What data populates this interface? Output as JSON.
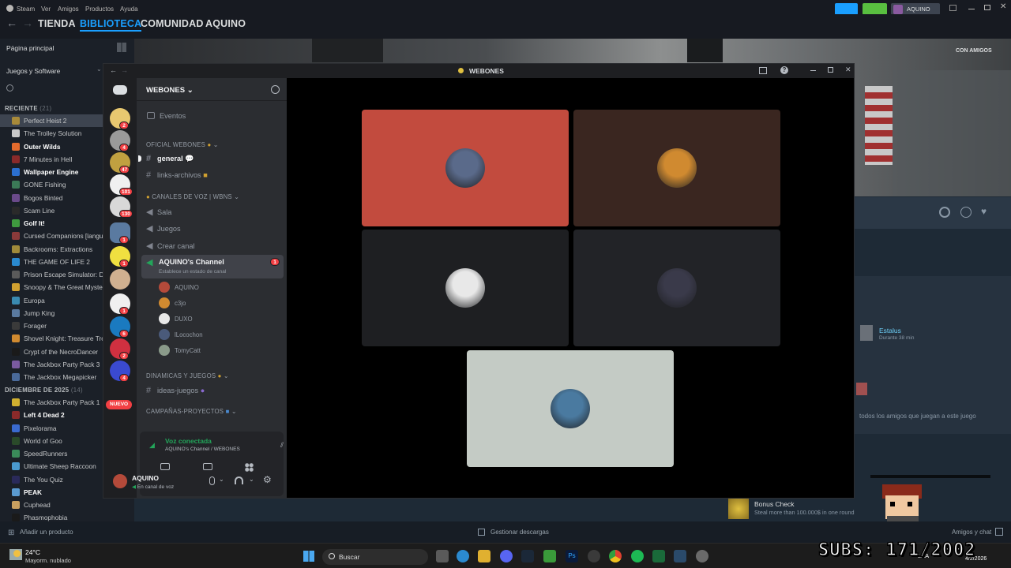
{
  "steam": {
    "menu": [
      "Steam",
      "Ver",
      "Amigos",
      "Productos",
      "Ayuda"
    ],
    "nav": {
      "store": "TIENDA",
      "library": "BIBLIOTECA",
      "community": "COMUNIDAD",
      "user": "AQUINO"
    },
    "account": "AQUINO",
    "home": "Página principal",
    "filter": "Juegos y Software",
    "recent_header": "RECIENTE",
    "recent_count": "(21)",
    "recent": [
      {
        "name": "Perfect Heist 2",
        "bold": false,
        "sel": true,
        "color": "#a88a3a"
      },
      {
        "name": "The Trolley Solution",
        "bold": false,
        "color": "#c9c9c9"
      },
      {
        "name": "Outer Wilds",
        "bold": true,
        "color": "#e46b2d"
      },
      {
        "name": "7 Minutes in Hell",
        "bold": false,
        "color": "#8a2a2a"
      },
      {
        "name": "Wallpaper Engine",
        "bold": true,
        "color": "#2b6fd0"
      },
      {
        "name": "GONE Fishing",
        "bold": false,
        "color": "#3b7a57"
      },
      {
        "name": "Bogos Binted",
        "bold": false,
        "color": "#6a4a8a"
      },
      {
        "name": "Scam Line",
        "bold": false,
        "color": "#2a2a2a"
      },
      {
        "name": "Golf It!",
        "bold": true,
        "color": "#3f9a3f"
      },
      {
        "name": "Cursed Companions [langu",
        "bold": false,
        "color": "#8a3a3a"
      },
      {
        "name": "Backrooms: Extractions",
        "bold": false,
        "color": "#a08a3a"
      },
      {
        "name": "THE GAME OF LIFE 2",
        "bold": false,
        "color": "#2a8ad0"
      },
      {
        "name": "Prison Escape Simulator: D",
        "bold": false,
        "color": "#5a5a5a"
      },
      {
        "name": "Snoopy & The Great Myste",
        "bold": false,
        "color": "#d0a030"
      },
      {
        "name": "Europa",
        "bold": false,
        "color": "#3a8ab0"
      },
      {
        "name": "Jump King",
        "bold": false,
        "color": "#5a7aa0"
      },
      {
        "name": "Forager",
        "bold": false,
        "color": "#3a3a3a"
      },
      {
        "name": "Shovel Knight: Treasure Tro",
        "bold": false,
        "color": "#d08a30"
      },
      {
        "name": "Crypt of the NecroDancer",
        "bold": false,
        "color": "#1a1a1a"
      },
      {
        "name": "The Jackbox Party Pack 3",
        "bold": false,
        "color": "#7a5aa0"
      },
      {
        "name": "The Jackbox Megapicker",
        "bold": false,
        "color": "#4a6a9a"
      }
    ],
    "dec_header": "DICIEMBRE DE 2025",
    "dec_count": "(14)",
    "december": [
      {
        "name": "The Jackbox Party Pack 1",
        "bold": false,
        "color": "#d0b030"
      },
      {
        "name": "Left 4 Dead 2",
        "bold": true,
        "color": "#8a2a2a"
      },
      {
        "name": "Pixelorama",
        "bold": false,
        "color": "#3a6ad0"
      },
      {
        "name": "World of Goo",
        "bold": false,
        "color": "#2a4a2a"
      },
      {
        "name": "SpeedRunners",
        "bold": false,
        "color": "#3a8a5a"
      },
      {
        "name": "Ultimate Sheep Raccoon",
        "bold": false,
        "color": "#4a9ad0"
      },
      {
        "name": "The You Quiz",
        "bold": false,
        "color": "#2a2a5a"
      },
      {
        "name": "PEAK",
        "bold": true,
        "color": "#5a9ad0"
      },
      {
        "name": "Cuphead",
        "bold": false,
        "color": "#c9a060"
      },
      {
        "name": "Phasmophobia",
        "bold": false,
        "color": "#1a1a1a"
      }
    ],
    "bottom_add": "Añadir un producto",
    "bottom_downloads": "Gestionar descargas",
    "bottom_chat": "Amigos y chat",
    "friends_tag": "CON AMIGOS",
    "friend_name": "Estalus",
    "friend_status": "Durante 38 min",
    "friends_note": "todos los amigos que juegan a este juego",
    "ach_title": "Bonus Check",
    "ach_desc": "Steal more than 100.000$ in one round"
  },
  "discord": {
    "window_title": "WEBONES",
    "server_name": "WEBONES",
    "events": "Eventos",
    "cat1": "OFICIAL WEBONES",
    "ch_general": "general",
    "ch_links": "links-archivos",
    "cat2": "CANALES DE VOZ | WBNS",
    "v_sala": "Sala",
    "v_juegos": "Juegos",
    "v_crear": "Crear canal",
    "v_active": "AQUINO's Channel",
    "v_active_status": "Establece un estado de canal",
    "v_active_badge": "1",
    "voice_users": [
      {
        "name": "AQUINO",
        "color": "#b44a3a"
      },
      {
        "name": "c3jo",
        "color": "#d08a30"
      },
      {
        "name": "DUXO",
        "color": "#e8e8e8"
      },
      {
        "name": "lLocochon",
        "color": "#4a5a7a"
      },
      {
        "name": "TomyCatt",
        "color": "#8a9a8a"
      }
    ],
    "cat3": "DINAMICAS Y JUEGOS",
    "ch_ideas": "ideas-juegos",
    "cat4": "CAMPAÑAS-PROYECTOS",
    "new_badge": "NUEVO",
    "voice_connected": "Voz conectada",
    "voice_sub": "AQUINO's Channel / WEBONES",
    "self_name": "AQUINO",
    "self_status": "En canal de voz",
    "server_badges": [
      "2",
      "4",
      "47",
      "101",
      "130",
      "1",
      "1",
      "",
      "1",
      "6",
      "2",
      "4"
    ],
    "tile_colors": [
      "#c24b3e",
      "#3a2620",
      "#1e1f22",
      "#222327",
      "#c4cbc5"
    ]
  },
  "weather": {
    "temp": "24°C",
    "desc": "Mayorm. nublado"
  },
  "taskbar": {
    "search": "Buscar",
    "lang": "LAA",
    "time": "4/2/2026"
  },
  "overlay": {
    "subs": "SUBS: 171/2002"
  }
}
